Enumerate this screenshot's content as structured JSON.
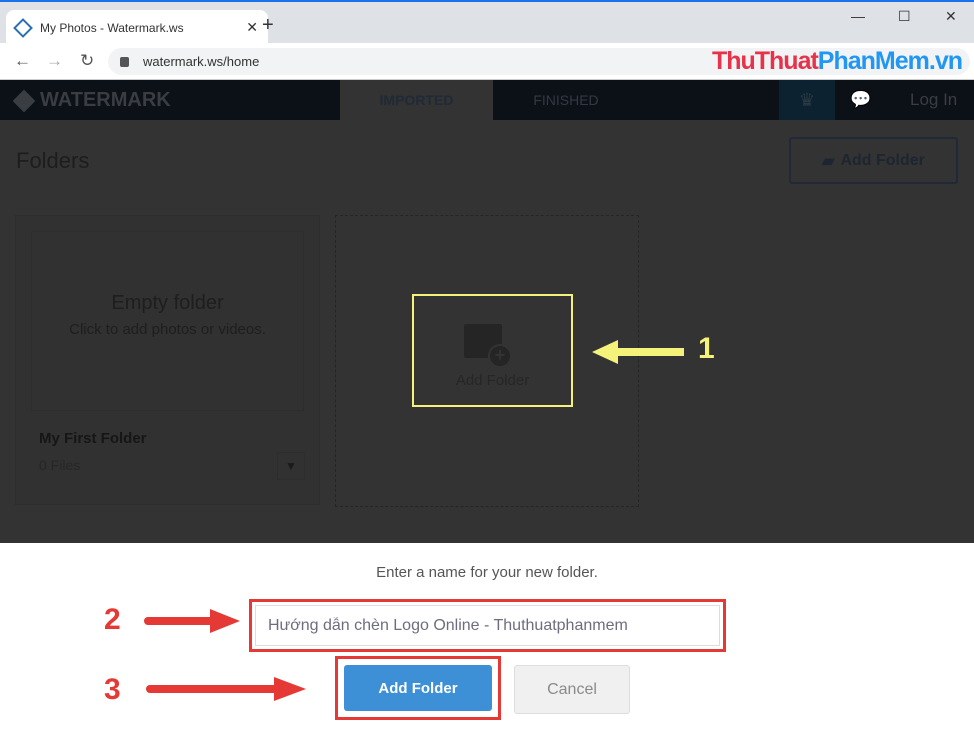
{
  "browser": {
    "tab_title": "My Photos - Watermark.ws",
    "url": "watermark.ws/home",
    "watermark_left": "ThuThuat",
    "watermark_right": "PhanMem.vn"
  },
  "nav": {
    "logo": "WATERMARK",
    "tabs": [
      {
        "label": "IMPORTED",
        "active": true
      },
      {
        "label": "FINISHED",
        "active": false
      }
    ],
    "login": "Log In"
  },
  "main": {
    "title": "Folders",
    "add_folder": "Add Folder",
    "folder": {
      "empty_title": "Empty folder",
      "empty_sub": "Click to add photos or videos.",
      "name": "My First Folder",
      "count": "0 Files"
    },
    "add_tile": "Add Folder"
  },
  "dialog": {
    "prompt": "Enter a name for your new folder.",
    "input_value": "Hướng dẫn chèn Logo Online - Thuthuatphanmem",
    "add": "Add Folder",
    "cancel": "Cancel"
  },
  "annotations": {
    "step1": "1",
    "step2": "2",
    "step3": "3",
    "highlight_yellow": "#f4f27a",
    "highlight_red": "#e53935"
  }
}
